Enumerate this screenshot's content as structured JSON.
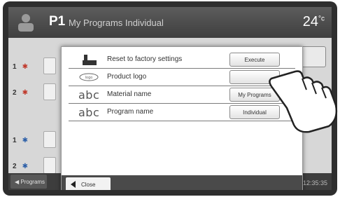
{
  "header": {
    "program_id": "P1",
    "title": "My Programs Individual",
    "temperature": "24",
    "temperature_unit": "°c"
  },
  "background_rows": [
    {
      "num": "1",
      "mark": "✱",
      "mark_color": "#c0392b"
    },
    {
      "num": "2",
      "mark": "✱",
      "mark_color": "#c0392b"
    },
    {
      "num": "1",
      "mark": "✱",
      "mark_color": "#2c5fa8"
    },
    {
      "num": "2",
      "mark": "✱",
      "mark_color": "#2c5fa8"
    }
  ],
  "dialog": {
    "rows": [
      {
        "icon": "factory-icon",
        "label": "Reset to factory settings",
        "button": "Execute"
      },
      {
        "icon": "product-logo-icon",
        "label": "Product logo",
        "button": ""
      },
      {
        "icon": "abc-text-icon",
        "label": "Material name",
        "button": "My Programs"
      },
      {
        "icon": "abc-text-icon",
        "label": "Program name",
        "button": "Individual"
      }
    ],
    "close_label": "Close"
  },
  "bottom": {
    "programs_label": "Programs",
    "time": "12:35:35"
  },
  "colors": {
    "header_bg": "#4a4a4a",
    "dialog_bg": "#ffffff",
    "footer_bg": "#4a4a4a"
  }
}
